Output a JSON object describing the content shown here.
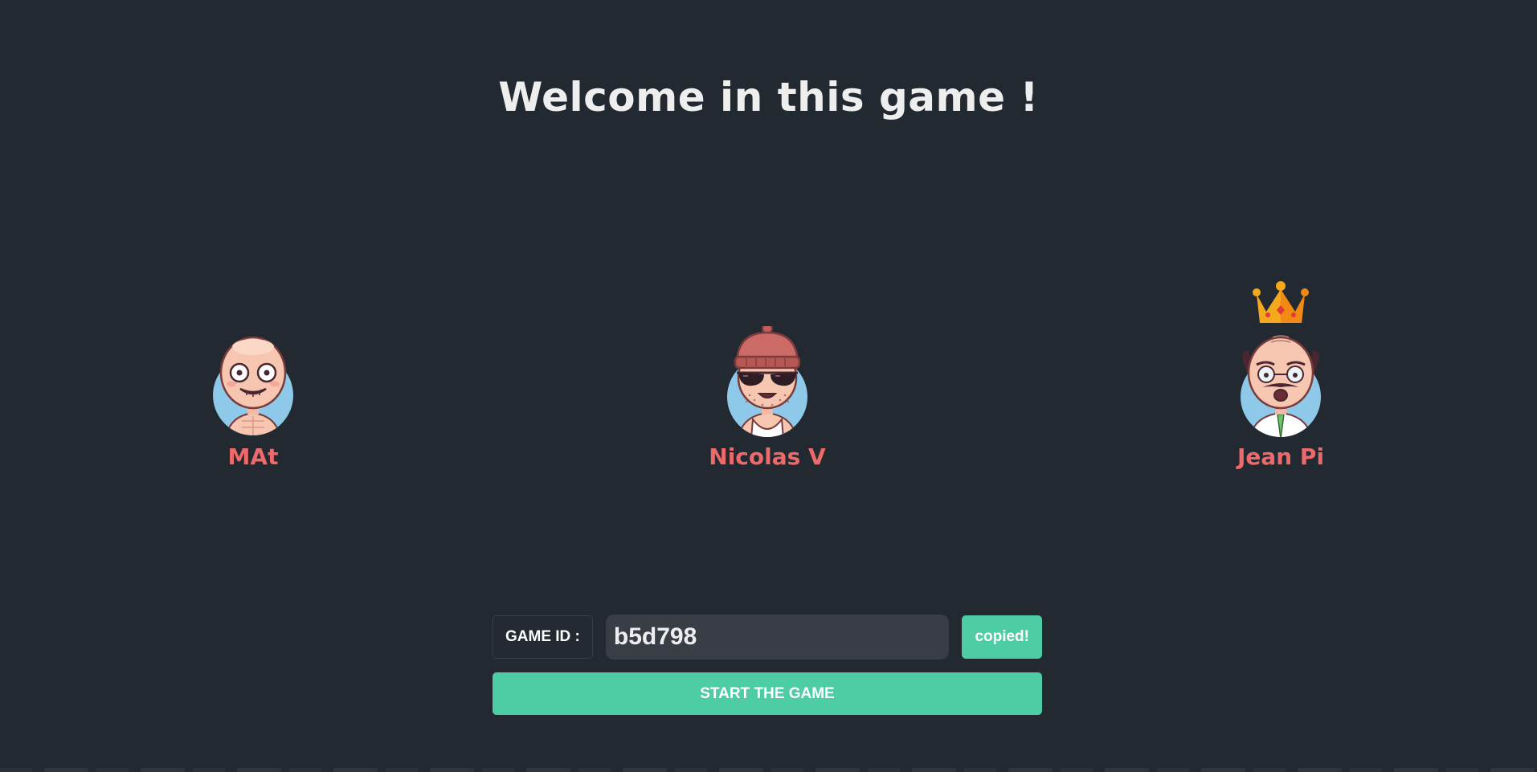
{
  "title": "Welcome in this game !",
  "players": [
    {
      "name": "MAt",
      "avatar": "bald-grinning-shirtless-avatar",
      "is_host": false
    },
    {
      "name": "Nicolas V",
      "avatar": "beanie-sunglasses-avatar",
      "is_host": false
    },
    {
      "name": "Jean Pi",
      "avatar": "old-professor-avatar",
      "is_host": true
    }
  ],
  "host_icon": "crown-icon",
  "game_id": {
    "label": "GAME ID :",
    "value": "b5d798",
    "copy_label": "copied!"
  },
  "start_label": "START THE GAME",
  "colors": {
    "background": "#232931",
    "title": "#eeeeee",
    "player_name": "#ee6969",
    "accent": "#4ecca3",
    "input_bg": "#393e46",
    "avatar_circle": "#8ec9ea"
  }
}
